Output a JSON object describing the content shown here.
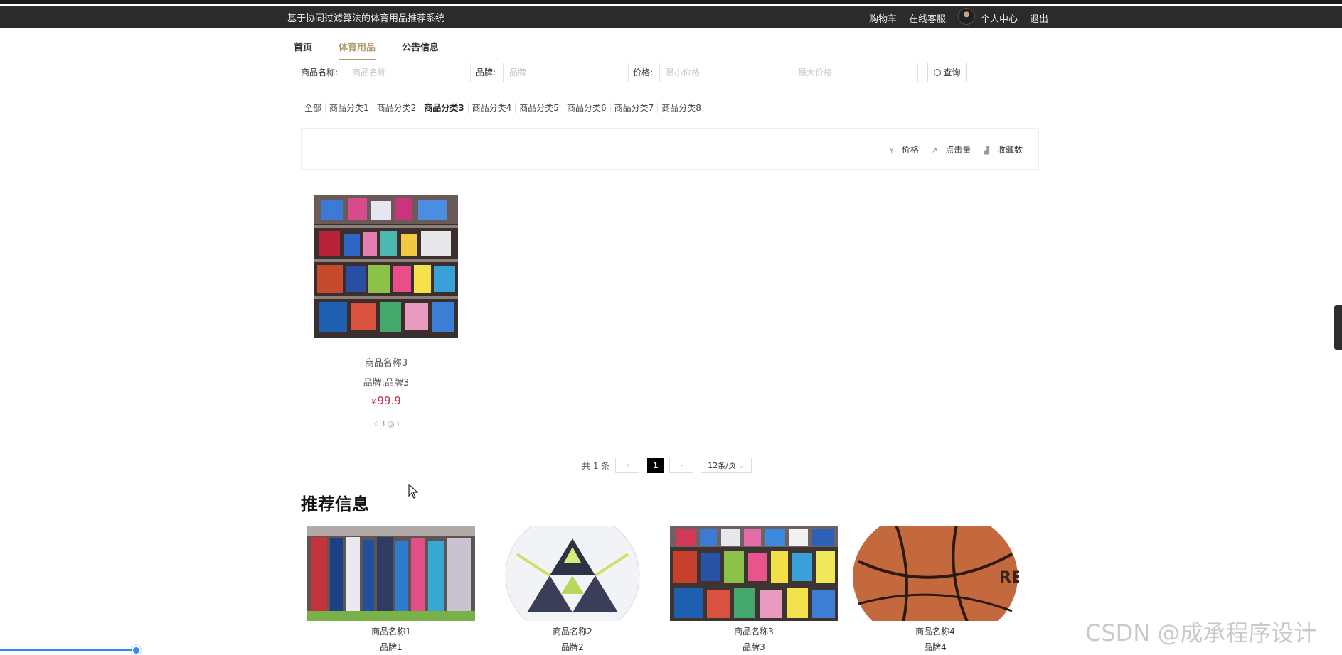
{
  "header": {
    "site_title": "基于协同过滤算法的体育用品推荐系统",
    "links": {
      "cart": "购物车",
      "service": "在线客服",
      "profile": "个人中心",
      "logout": "退出"
    }
  },
  "nav": {
    "home": "首页",
    "products": "体育用品",
    "notices": "公告信息",
    "active": "体育用品"
  },
  "search": {
    "name_label": "商品名称:",
    "name_placeholder": "商品名称",
    "brand_label": "品牌:",
    "brand_placeholder": "品牌",
    "price_label": "价格:",
    "min_price_placeholder": "最小价格",
    "max_price_placeholder": "最大价格",
    "query_button": "查询"
  },
  "categories": [
    "全部",
    "商品分类1",
    "商品分类2",
    "商品分类3",
    "商品分类4",
    "商品分类5",
    "商品分类6",
    "商品分类7",
    "商品分类8"
  ],
  "active_category": "商品分类3",
  "sort": {
    "price": "价格",
    "clicks": "点击量",
    "favorites": "收藏数"
  },
  "product": {
    "name": "商品名称3",
    "brand": "品牌:品牌3",
    "currency": "¥",
    "price": "99.9",
    "likes": "3",
    "views": "3"
  },
  "pager": {
    "total": "共 1 条",
    "current": "1",
    "page_size": "12条/页"
  },
  "recommend": {
    "title": "推荐信息",
    "items": [
      {
        "name": "商品名称1",
        "brand": "品牌1"
      },
      {
        "name": "商品名称2",
        "brand": "品牌2"
      },
      {
        "name": "商品名称3",
        "brand": "品牌3"
      },
      {
        "name": "商品名称4",
        "brand": "品牌4"
      }
    ]
  },
  "watermark": "CSDN @成承程序设计",
  "colors": {
    "accent": "#b09a6c",
    "price": "#c0314a",
    "topbar": "#2b2b2b"
  }
}
